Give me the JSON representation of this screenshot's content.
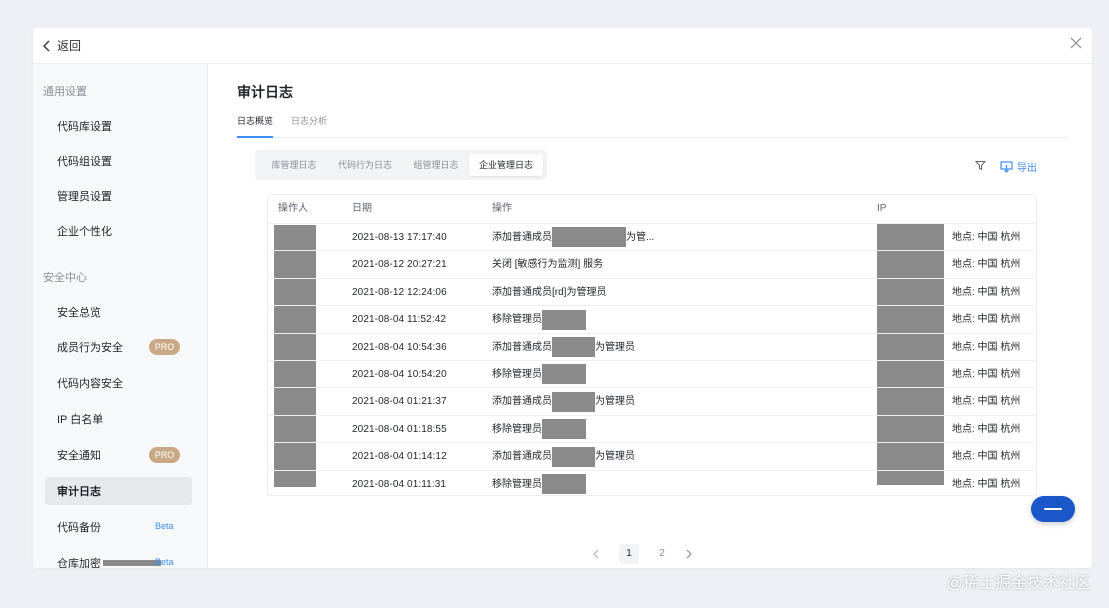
{
  "topbar": {
    "back_label": "返回"
  },
  "sidebar": {
    "sections": [
      {
        "title": "通用设置"
      },
      {
        "title": "安全中心"
      }
    ],
    "items": [
      {
        "label": "代码库设置"
      },
      {
        "label": "代码组设置"
      },
      {
        "label": "管理员设置"
      },
      {
        "label": "企业个性化"
      },
      {
        "label": "安全总览"
      },
      {
        "label": "成员行为安全",
        "badge": "PRO"
      },
      {
        "label": "代码内容安全"
      },
      {
        "label": "IP 白名单"
      },
      {
        "label": "安全通知",
        "badge": "PRO"
      },
      {
        "label": "审计日志",
        "active": true
      },
      {
        "label": "代码备份",
        "badge": "Beta"
      },
      {
        "label": "仓库加密",
        "badge": "Beta"
      }
    ]
  },
  "main": {
    "title": "审计日志",
    "tabs": [
      {
        "label": "日志概览",
        "active": true
      },
      {
        "label": "日志分析"
      }
    ],
    "segments": [
      {
        "label": "库管理日志"
      },
      {
        "label": "代码行为日志"
      },
      {
        "label": "组管理日志"
      },
      {
        "label": "企业管理日志",
        "active": true
      }
    ],
    "export_label": "导出",
    "table": {
      "columns": [
        "操作人",
        "日期",
        "操作",
        "IP"
      ],
      "rows": [
        {
          "date": "2021-08-13 17:17:40",
          "op_prefix": "添加普通成员",
          "op_suffix": "为管...",
          "location": "地点: 中国 杭州"
        },
        {
          "date": "2021-08-12 20:27:21",
          "op_prefix": "关闭 [敏感行为监测] 服务",
          "op_suffix": "",
          "location": "地点: 中国 杭州"
        },
        {
          "date": "2021-08-12 12:24:06",
          "op_prefix": "添加普通成员[rd]为管理员",
          "op_suffix": "",
          "location": "地点: 中国 杭州"
        },
        {
          "date": "2021-08-04 11:52:42",
          "op_prefix": "移除管理员",
          "op_suffix": "",
          "location": "地点: 中国 杭州"
        },
        {
          "date": "2021-08-04 10:54:36",
          "op_prefix": "添加普通成员",
          "op_suffix": "为管理员",
          "location": "地点: 中国 杭州"
        },
        {
          "date": "2021-08-04 10:54:20",
          "op_prefix": "移除管理员",
          "op_suffix": "",
          "location": "地点: 中国 杭州"
        },
        {
          "date": "2021-08-04 01:21:37",
          "op_prefix": "添加普通成员",
          "op_suffix": "为管理员",
          "location": "地点: 中国 杭州"
        },
        {
          "date": "2021-08-04 01:18:55",
          "op_prefix": "移除管理员",
          "op_suffix": "",
          "location": "地点: 中国 杭州"
        },
        {
          "date": "2021-08-04 01:14:12",
          "op_prefix": "添加普通成员",
          "op_suffix": "为管理员",
          "location": "地点: 中国 杭州"
        },
        {
          "date": "2021-08-04 01:11:31",
          "op_prefix": "移除管理员",
          "op_suffix": "",
          "location": "地点: 中国 杭州"
        }
      ]
    },
    "pagination": {
      "pages": [
        "1",
        "2"
      ],
      "current": "1"
    }
  },
  "watermark": "@稀土掘金技术社区",
  "colors": {
    "accent": "#3b8ff6",
    "pro_badge": "#c9a886",
    "fab": "#1a57c9"
  }
}
